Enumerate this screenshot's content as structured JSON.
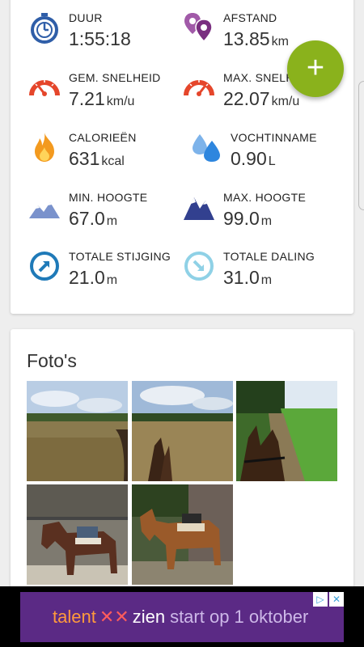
{
  "stats": {
    "duration": {
      "label": "DUUR",
      "value": "1:55:18",
      "unit": ""
    },
    "distance": {
      "label": "AFSTAND",
      "value": "13.85",
      "unit": "km"
    },
    "avg_speed": {
      "label": "GEM. SNELHEID",
      "value": "7.21",
      "unit": "km/u"
    },
    "max_speed": {
      "label": "MAX. SNELH",
      "value": "22.07",
      "unit": "km/u"
    },
    "calories": {
      "label": "CALORIEËN",
      "value": "631",
      "unit": "kcal"
    },
    "hydration": {
      "label": "VOCHTINNAME",
      "value": "0.90",
      "unit": "L"
    },
    "min_altitude": {
      "label": "MIN. HOOGTE",
      "value": "67.0",
      "unit": "m"
    },
    "max_altitude": {
      "label": "MAX. HOOGTE",
      "value": "99.0",
      "unit": "m"
    },
    "total_ascent": {
      "label": "TOTALE STIJGING",
      "value": "21.0",
      "unit": "m"
    },
    "total_descent": {
      "label": "TOTALE DALING",
      "value": "31.0",
      "unit": "m"
    }
  },
  "fab": {
    "label": "+"
  },
  "photos": {
    "title": "Foto's",
    "items": [
      "heath-landscape-photo",
      "heath-landscape-horse-ears-photo",
      "field-path-horse-ears-photo",
      "horse-stable-photo",
      "horse-yard-photo"
    ]
  },
  "ad": {
    "brand_part1": "talent",
    "brand_symbol": "✕✕",
    "brand_part2": "zien",
    "tagline": "start op 1 oktober",
    "adchoices_icon": "▷",
    "close_icon": "✕"
  },
  "colors": {
    "fab": "#8ab21c",
    "ad_background": "#5b2a85",
    "icon_blue": "#2f5ea8",
    "icon_orange": "#e5462b",
    "icon_purple": "#8a3b8e"
  }
}
